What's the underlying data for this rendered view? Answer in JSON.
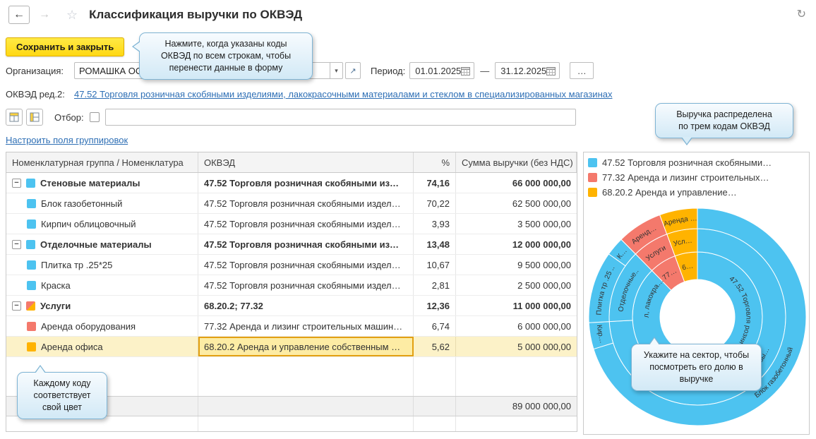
{
  "header": {
    "title": "Классификация выручки по ОКВЭД"
  },
  "toolbar": {
    "save_button": "Сохранить и закрыть"
  },
  "callouts": {
    "save": "Нажмите, когда указаны коды\nОКВЭД по всем строкам, чтобы\nперенести данные в форму",
    "legend": "Выручка распределена\nпо трем кодам ОКВЭД",
    "sector": "Укажите на сектор, чтобы\nпосмотреть его долю в\nвыручке",
    "colors": "Каждому коду\nсоответствует\nсвой цвет"
  },
  "form": {
    "organization_label": "Организация:",
    "organization_value": "РОМАШКА ОО",
    "period_label": "Период:",
    "period_from": "01.01.2025",
    "dash": "—",
    "period_to": "31.12.2025",
    "more_button": "…",
    "okved_label": "ОКВЭД ред.2:",
    "okved_link": "47.52 Торговля розничная скобяными изделиями, лакокрасочными материалами и стеклом в специализированных магазинах",
    "filter_label": "Отбор:",
    "configure_link": "Настроить поля группировок"
  },
  "palette": {
    "blue": "#4DC3F0",
    "red": "#F4796C",
    "yellow": "#FFB300"
  },
  "table": {
    "columns": [
      "Номенклатурная группа / Номенклатура",
      "ОКВЭД",
      "%",
      "Сумма выручки (без НДС)"
    ],
    "rows": [
      {
        "group": true,
        "bold": true,
        "color": "#4DC3F0",
        "name": "Стеновые материалы",
        "okved": "47.52 Торговля розничная скобяными из…",
        "percent": "74,16",
        "sum": "66 000 000,00"
      },
      {
        "color": "#4DC3F0",
        "name": "Блок газобетонный",
        "okved": "47.52 Торговля розничная скобяными издел…",
        "percent": "70,22",
        "sum": "62 500 000,00"
      },
      {
        "color": "#4DC3F0",
        "name": "Кирпич облицовочный",
        "okved": "47.52 Торговля розничная скобяными издел…",
        "percent": "3,93",
        "sum": "3 500 000,00"
      },
      {
        "group": true,
        "bold": true,
        "color": "#4DC3F0",
        "name": "Отделочные материалы",
        "okved": "47.52 Торговля розничная скобяными из…",
        "percent": "13,48",
        "sum": "12 000 000,00"
      },
      {
        "color": "#4DC3F0",
        "name": "Плитка тр .25*25",
        "okved": "47.52 Торговля розничная скобяными издел…",
        "percent": "10,67",
        "sum": "9 500 000,00"
      },
      {
        "color": "#4DC3F0",
        "name": "Краска",
        "okved": "47.52 Торговля розничная скобяными издел…",
        "percent": "2,81",
        "sum": "2 500 000,00"
      },
      {
        "group": true,
        "bold": true,
        "multi": true,
        "name": "Услуги",
        "okved": "68.20.2; 77.32",
        "percent": "12,36",
        "sum": "11 000 000,00"
      },
      {
        "color": "#F4796C",
        "name": "Аренда оборудования",
        "okved": "77.32 Аренда и лизинг строительных машин…",
        "percent": "6,74",
        "sum": "6 000 000,00"
      },
      {
        "color": "#FFB300",
        "name": "Аренда офиса",
        "okved": "68.20.2 Аренда и управление собственным …",
        "percent": "5,62",
        "sum": "5 000 000,00",
        "selected": true
      }
    ],
    "total": "89 000 000,00"
  },
  "legend": [
    {
      "color": "#4DC3F0",
      "label": "47.52 Торговля розничная скобяными…"
    },
    {
      "color": "#F4796C",
      "label": "77.32 Аренда и лизинг строительных…"
    },
    {
      "color": "#FFB300",
      "label": "68.20.2 Аренда и управление…"
    }
  ],
  "chart": {
    "type": "sunburst",
    "total": 100,
    "rings": [
      {
        "name": "okved-codes",
        "segments": [
          {
            "label": "47.52 Торговля розни…",
            "value": 87.64,
            "color": "#4DC3F0",
            "labelAngle": 85
          },
          {
            "label": "77…",
            "value": 6.74,
            "color": "#F4796C",
            "labelAngle": 327
          },
          {
            "label": "6…",
            "value": 5.62,
            "color": "#FFB300",
            "labelAngle": 349
          }
        ]
      },
      {
        "name": "groups",
        "segments": [
          {
            "label": "Стеновы…",
            "value": 74.16,
            "color": "#4DC3F0",
            "labelAngle": 127
          },
          {
            "label": "Отделочные..",
            "value": 13.48,
            "color": "#4DC3F0",
            "labelAngle": 291
          },
          {
            "label": "Услуги",
            "value": 6.74,
            "color": "#F4796C",
            "labelAngle": 327
          },
          {
            "label": "Усл…",
            "value": 5.62,
            "color": "#FFB300",
            "labelAngle": 349
          }
        ]
      },
      {
        "name": "items",
        "segments": [
          {
            "label": "Блок газобетонный",
            "value": 70.22,
            "color": "#4DC3F0",
            "labelAngle": 126
          },
          {
            "label": "Кир…",
            "value": 3.93,
            "color": "#4DC3F0",
            "labelAngle": 260
          },
          {
            "label": "Плитка тр .25 ..",
            "value": 10.67,
            "color": "#4DC3F0",
            "labelAngle": 286
          },
          {
            "label": "К…",
            "value": 2.81,
            "color": "#4DC3F0",
            "labelAngle": 310
          },
          {
            "label": "Аренд…",
            "value": 6.74,
            "color": "#F4796C",
            "labelAngle": 327
          },
          {
            "label": "Аренда …",
            "value": 5.62,
            "color": "#FFB300",
            "labelAngle": 350
          }
        ]
      }
    ],
    "extra_labels": [
      {
        "label": "л, лакокра…",
        "ring": 0,
        "angle": 293
      }
    ]
  }
}
